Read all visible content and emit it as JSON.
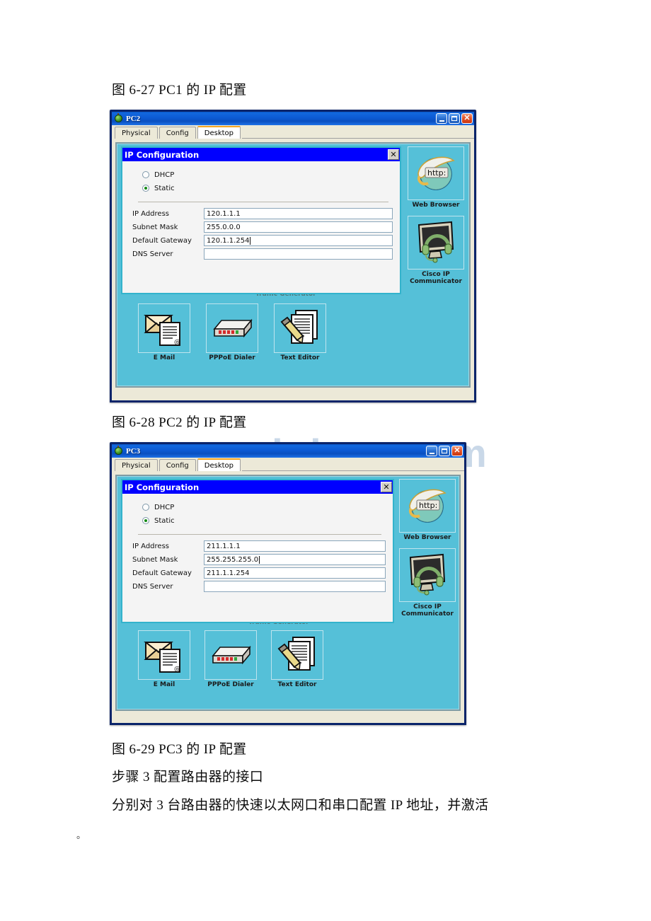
{
  "document": {
    "caption_1": "图 6-27 PC1 的 IP 配置",
    "caption_2": "图 6-28 PC2 的 IP 配置",
    "caption_3": "图 6-29 PC3 的 IP 配置",
    "body_1": "步骤 3 配置路由器的接口",
    "body_2": "分别对 3 台路由器的快速以太网口和串口配置 IP 地址，并激活",
    "trailing_period": "。",
    "watermark": "www.bdocx.com"
  },
  "colors": {
    "titlebar_blue": "#0a4fc0",
    "window_border": "#0a246a",
    "desktop_teal": "#55c0d8",
    "dialog_title_blue": "#0000ff",
    "dialog_border": "#33b3cc",
    "tab_active_accent": "#f5a623",
    "panel_beige": "#ece9d8",
    "radio_selected": "#138a13"
  },
  "windows": [
    {
      "id": "pc2",
      "title": "PC2",
      "titlebar_icon": "packet-tracer-pc-icon",
      "window_buttons": [
        {
          "name": "minimize-button",
          "glyph": "_"
        },
        {
          "name": "maximize-button",
          "glyph": "□"
        },
        {
          "name": "close-button",
          "glyph": "✕"
        }
      ],
      "tabs": [
        {
          "label": "Physical",
          "active": false
        },
        {
          "label": "Config",
          "active": false
        },
        {
          "label": "Desktop",
          "active": true
        }
      ],
      "desktop_icons": [
        {
          "label": "E Mail",
          "icon": "email-envelope-icon"
        },
        {
          "label": "PPPoE Dialer",
          "icon": "modem-device-icon"
        },
        {
          "label": "Text Editor",
          "icon": "pencil-document-icon"
        }
      ],
      "sidebar_icons": [
        {
          "label": "Web Browser",
          "icon": "web-browser-globe-icon"
        },
        {
          "label": "Cisco IP Communicator",
          "icon": "monitor-headset-icon"
        }
      ],
      "obscured_label": "Traffic Generator",
      "dialog": {
        "title": "IP Configuration",
        "close_label": "✕",
        "mode_options": [
          {
            "label": "DHCP",
            "selected": false
          },
          {
            "label": "Static",
            "selected": true
          }
        ],
        "fields": [
          {
            "label": "IP Address",
            "value": "120.1.1.1",
            "caret": false
          },
          {
            "label": "Subnet Mask",
            "value": "255.0.0.0",
            "caret": false
          },
          {
            "label": "Default Gateway",
            "value": "120.1.1.254",
            "caret": true
          },
          {
            "label": "DNS Server",
            "value": "",
            "caret": false
          }
        ]
      }
    },
    {
      "id": "pc3",
      "title": "PC3",
      "titlebar_icon": "packet-tracer-pc-icon",
      "window_buttons": [
        {
          "name": "minimize-button",
          "glyph": "_"
        },
        {
          "name": "maximize-button",
          "glyph": "□"
        },
        {
          "name": "close-button",
          "glyph": "✕"
        }
      ],
      "tabs": [
        {
          "label": "Physical",
          "active": false
        },
        {
          "label": "Config",
          "active": false
        },
        {
          "label": "Desktop",
          "active": true
        }
      ],
      "desktop_icons": [
        {
          "label": "E Mail",
          "icon": "email-envelope-icon"
        },
        {
          "label": "PPPoE Dialer",
          "icon": "modem-device-icon"
        },
        {
          "label": "Text Editor",
          "icon": "pencil-document-icon"
        }
      ],
      "sidebar_icons": [
        {
          "label": "Web Browser",
          "icon": "web-browser-globe-icon"
        },
        {
          "label": "Cisco IP Communicator",
          "icon": "monitor-headset-icon"
        }
      ],
      "obscured_label": "Traffic Generator",
      "dialog": {
        "title": "IP Configuration",
        "close_label": "✕",
        "mode_options": [
          {
            "label": "DHCP",
            "selected": false
          },
          {
            "label": "Static",
            "selected": true
          }
        ],
        "fields": [
          {
            "label": "IP Address",
            "value": "211.1.1.1",
            "caret": false
          },
          {
            "label": "Subnet Mask",
            "value": "255.255.255.0",
            "caret": true
          },
          {
            "label": "Default Gateway",
            "value": "211.1.1.254",
            "caret": false
          },
          {
            "label": "DNS Server",
            "value": "",
            "caret": false
          }
        ]
      }
    }
  ]
}
